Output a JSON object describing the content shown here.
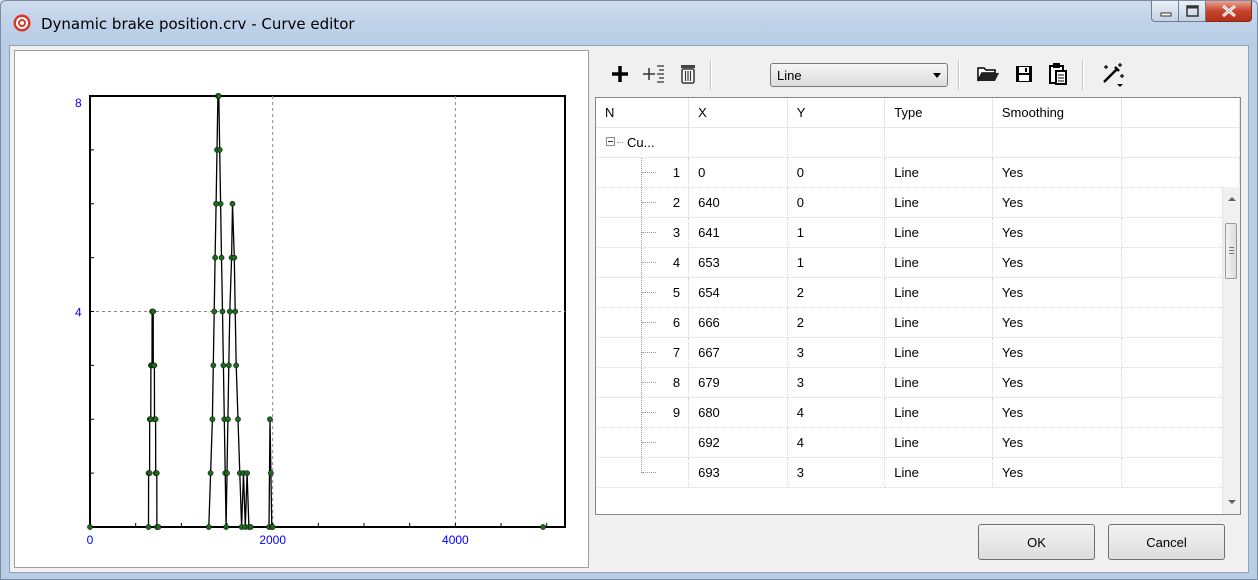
{
  "window": {
    "title": "Dynamic brake position.crv - Curve editor"
  },
  "toolbar": {
    "icons": [
      "add-icon",
      "insert-icon",
      "delete-icon",
      "open-icon",
      "save-icon",
      "paste-icon",
      "magic-wand-icon"
    ],
    "type_select": {
      "selected": "Line"
    }
  },
  "table": {
    "columns": [
      "N",
      "X",
      "Y",
      "Type",
      "Smoothing"
    ],
    "root_label": "Cu...",
    "rows": [
      {
        "n": "1",
        "x": "0",
        "y": "0",
        "type": "Line",
        "smoothing": "Yes"
      },
      {
        "n": "2",
        "x": "640",
        "y": "0",
        "type": "Line",
        "smoothing": "Yes"
      },
      {
        "n": "3",
        "x": "641",
        "y": "1",
        "type": "Line",
        "smoothing": "Yes"
      },
      {
        "n": "4",
        "x": "653",
        "y": "1",
        "type": "Line",
        "smoothing": "Yes"
      },
      {
        "n": "5",
        "x": "654",
        "y": "2",
        "type": "Line",
        "smoothing": "Yes"
      },
      {
        "n": "6",
        "x": "666",
        "y": "2",
        "type": "Line",
        "smoothing": "Yes"
      },
      {
        "n": "7",
        "x": "667",
        "y": "3",
        "type": "Line",
        "smoothing": "Yes"
      },
      {
        "n": "8",
        "x": "679",
        "y": "3",
        "type": "Line",
        "smoothing": "Yes"
      },
      {
        "n": "9",
        "x": "680",
        "y": "4",
        "type": "Line",
        "smoothing": "Yes"
      },
      {
        "n": "",
        "x": "692",
        "y": "4",
        "type": "Line",
        "smoothing": "Yes"
      },
      {
        "n": "",
        "x": "693",
        "y": "3",
        "type": "Line",
        "smoothing": "Yes"
      }
    ]
  },
  "buttons": {
    "ok": "OK",
    "cancel": "Cancel"
  },
  "colors": {
    "axis_label": "#0000ff",
    "point_fill": "#1e6b1e",
    "close_button": "#c7442c"
  },
  "chart_data": {
    "type": "line",
    "x_ticks": [
      "0",
      "2000",
      "4000"
    ],
    "y_ticks": [
      "8",
      "4"
    ],
    "xlim": [
      0,
      5200
    ],
    "ylim": [
      0,
      8
    ],
    "grid": true,
    "series": [
      {
        "x": [
          0,
          640,
          641,
          653,
          654,
          666,
          667,
          679,
          680,
          692,
          693,
          705,
          706,
          718,
          719,
          731,
          732,
          750,
          1300,
          1320,
          1340,
          1350,
          1360,
          1370,
          1380,
          1390,
          1400,
          1410,
          1420,
          1430,
          1440,
          1450,
          1460,
          1470,
          1480,
          1490,
          1500,
          1510,
          1520,
          1530,
          1550,
          1560,
          1580,
          1590,
          1600,
          1620,
          1640,
          1660,
          1680,
          1700,
          1720,
          1740,
          1760,
          1960,
          1970,
          1980,
          1990,
          2000,
          4960
        ],
        "y": [
          0,
          0,
          1,
          1,
          2,
          2,
          3,
          3,
          4,
          4,
          3,
          3,
          2,
          2,
          1,
          1,
          0,
          0,
          0,
          1,
          2,
          3,
          4,
          5,
          6,
          7,
          8,
          8,
          7,
          6,
          5,
          4,
          3,
          2,
          1,
          0,
          1,
          2,
          3,
          4,
          5,
          6,
          5,
          4,
          3,
          2,
          1,
          0,
          1,
          0,
          1,
          0,
          0,
          0,
          2,
          1,
          0,
          0,
          0
        ]
      }
    ]
  }
}
